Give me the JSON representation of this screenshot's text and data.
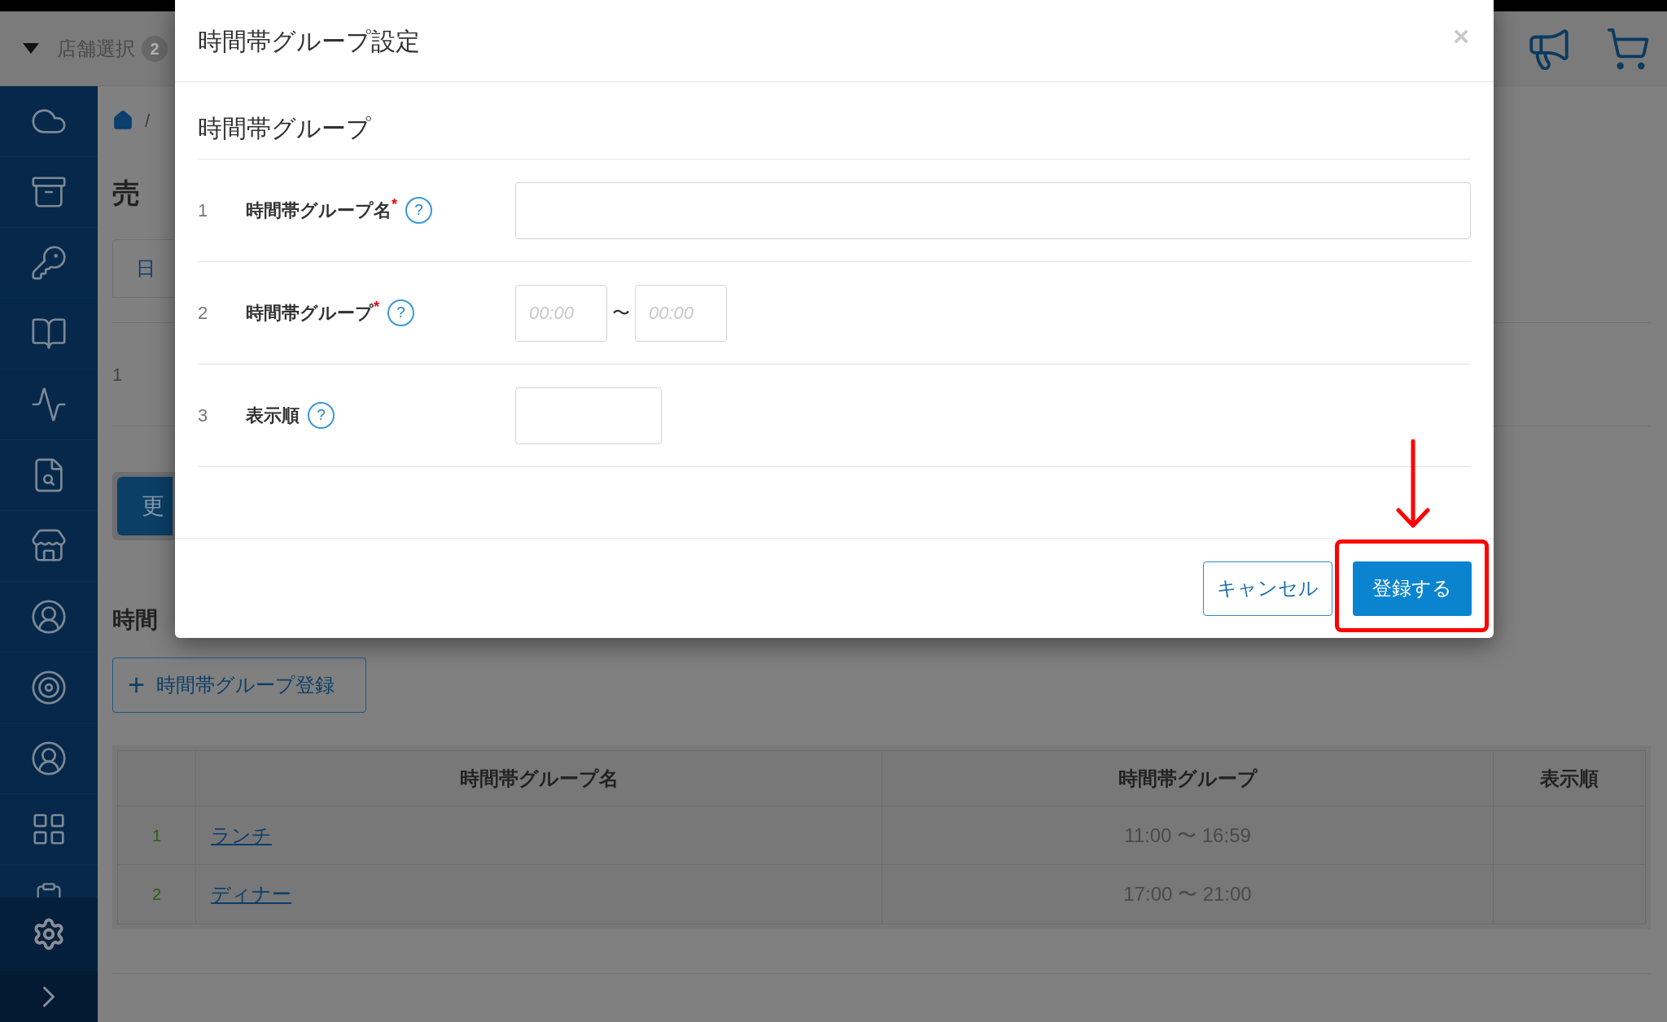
{
  "header": {
    "store_select": {
      "label": "店舗選択",
      "count": "2"
    }
  },
  "breadcrumb": {
    "separator": "/"
  },
  "page": {
    "title": "売",
    "tab": "日",
    "row_number": "1",
    "button": "更",
    "section_title": "時間"
  },
  "add_button": {
    "icon": "+",
    "label": "時間帯グループ登録"
  },
  "table": {
    "columns": [
      "時間帯グループ名",
      "時間帯グループ",
      "表示順"
    ],
    "rows": [
      {
        "no": "1",
        "name": "ランチ",
        "time": "11:00 〜 16:59"
      },
      {
        "no": "2",
        "name": "ディナー",
        "time": "17:00 〜 21:00"
      }
    ]
  },
  "modal": {
    "title": "時間帯グループ設定",
    "close": "×",
    "section_title": "時間帯グループ",
    "required_mark": "*",
    "fields": [
      {
        "no": "1",
        "label": "時間帯グループ名",
        "required": true,
        "help": "?",
        "kind": "text"
      },
      {
        "no": "2",
        "label": "時間帯グループ",
        "required": true,
        "help": "?",
        "kind": "time_range",
        "from_placeholder": "00:00",
        "separator": "〜",
        "to_placeholder": "00:00"
      },
      {
        "no": "3",
        "label": "表示順",
        "required": false,
        "help": "?",
        "kind": "short"
      }
    ],
    "buttons": {
      "cancel": "キャンセル",
      "submit": "登録する"
    }
  }
}
